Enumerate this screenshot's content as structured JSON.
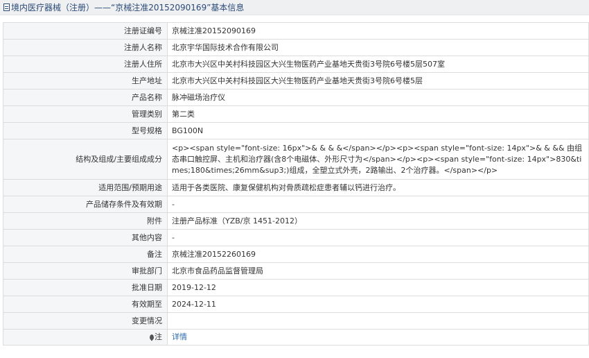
{
  "title": "境内医疗器械（注册）——“京械注准20152090169”基本信息",
  "rows": [
    {
      "label": "注册证编号",
      "value": "京械注准20152090169"
    },
    {
      "label": "注册人名称",
      "value": "北京宇华国际技术合作有限公司"
    },
    {
      "label": "注册人住所",
      "value": "北京市大兴区中关村科技园区大兴生物医药产业基地天贵街3号院6号楼5层507室"
    },
    {
      "label": "生产地址",
      "value": "北京市大兴区中关村科技园区大兴生物医药产业基地天贵街3号院6号楼5层"
    },
    {
      "label": "产品名称",
      "value": "脉冲磁场治疗仪"
    },
    {
      "label": "管理类别",
      "value": "第二类"
    },
    {
      "label": "型号规格",
      "value": "BG100N"
    },
    {
      "label": "结构及组成/主要组成成分",
      "value": "<p><span style=\"font-size: 16px\">& & & &</span></p><p><span style=\"font-size: 14px\">& & && 由组态串口触控屏、主机和治疗器(含8个电磁体、外形尺寸为</span></p><p><span style=\"font-size: 14px\">830&times;180&times;26mm&sup3;)组成，全塑立式外壳，2路输出、2个治疗器。</span></p>"
    },
    {
      "label": "适用范围/预期用途",
      "value": "适用于各类医院、康复保健机构对骨质疏松症患者辅以钙进行治疗。"
    },
    {
      "label": "产品储存条件及有效期",
      "value": "-"
    },
    {
      "label": "附件",
      "value": "注册产品标准（YZB/京 1451-2012）"
    },
    {
      "label": "其他内容",
      "value": "-"
    },
    {
      "label": "备注",
      "value": "京械注准20152260169"
    },
    {
      "label": "审批部门",
      "value": "北京市食品药品监督管理局"
    },
    {
      "label": "批准日期",
      "value": "2019-12-12"
    },
    {
      "label": "有效期至",
      "value": "2024-12-11"
    },
    {
      "label": "变更情况",
      "value": ""
    }
  ],
  "note": {
    "label": "注",
    "link": "详情"
  }
}
